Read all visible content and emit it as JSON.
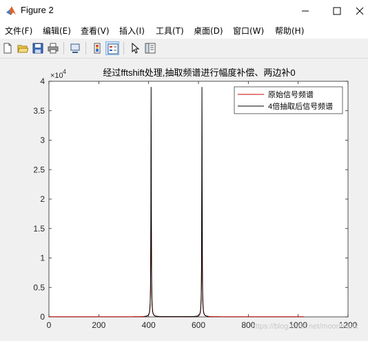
{
  "window": {
    "title": "Figure 2"
  },
  "menu": [
    "文件(F)",
    "编辑(E)",
    "查看(V)",
    "插入(I)",
    "工具(T)",
    "桌面(D)",
    "窗口(W)",
    "帮助(H)"
  ],
  "toolbar": {
    "icons": [
      "new-figure-icon",
      "open-file-icon",
      "save-icon",
      "print-icon",
      "link-plot-icon",
      "colorbar-icon",
      "legend-icon",
      "pointer-icon",
      "property-editor-icon"
    ]
  },
  "chart_data": {
    "type": "line",
    "title": "经过fftshift处理,抽取频谱进行幅度补偿、两边补0",
    "xlabel": "",
    "ylabel": "",
    "xlim": [
      0,
      1200
    ],
    "ylim": [
      0,
      4
    ],
    "y_exponent_label": "×10",
    "y_exponent_power": "4",
    "xticks": [
      "0",
      "200",
      "400",
      "600",
      "800",
      "1000",
      "1200"
    ],
    "yticks": [
      "0",
      "0.5",
      "1",
      "1.5",
      "2",
      "2.5",
      "3",
      "3.5",
      "4"
    ],
    "series": [
      {
        "name": "原始信号频谱",
        "color": "#c00000",
        "x_range": [
          0,
          1024
        ],
        "peaks": [
          [
            410,
            2.3
          ],
          [
            614,
            2.3
          ]
        ]
      },
      {
        "name": "4倍抽取后信号频谱",
        "color": "#000000",
        "x_range": [
          384,
          640
        ],
        "peaks": [
          [
            410,
            3.9
          ],
          [
            614,
            3.9
          ]
        ]
      }
    ],
    "legend_position": "top-right",
    "grid": false
  },
  "watermark": "https://blog.csdn.net/moonblank"
}
